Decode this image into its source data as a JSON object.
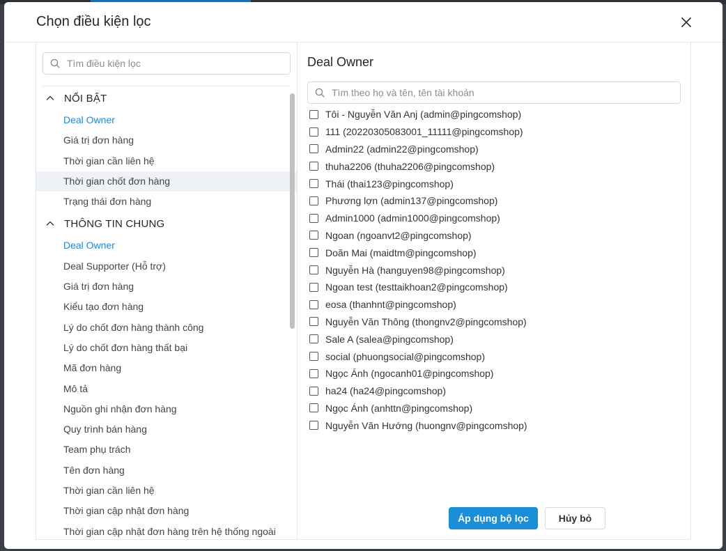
{
  "modal": {
    "title": "Chọn điều kiện lọc"
  },
  "left": {
    "search_placeholder": "Tìm điều kiện lọc",
    "groups": [
      {
        "title": "NỔI BẬT",
        "items": [
          {
            "label": "Deal Owner"
          },
          {
            "label": "Giá trị đơn hàng"
          },
          {
            "label": "Thời gian cần liên hệ"
          },
          {
            "label": "Thời gian chốt đơn hàng"
          },
          {
            "label": "Trạng thái đơn hàng"
          }
        ]
      },
      {
        "title": "THÔNG TIN CHUNG",
        "items": [
          {
            "label": "Deal Owner"
          },
          {
            "label": "Deal Supporter (Hỗ trợ)"
          },
          {
            "label": "Giá trị đơn hàng"
          },
          {
            "label": "Kiểu tạo đơn hàng"
          },
          {
            "label": "Lý do chốt đơn hàng thành công"
          },
          {
            "label": "Lý do chốt đơn hàng thất bại"
          },
          {
            "label": "Mã đơn hàng"
          },
          {
            "label": "Mô tả"
          },
          {
            "label": "Nguồn ghi nhận đơn hàng"
          },
          {
            "label": "Quy trình bán hàng"
          },
          {
            "label": "Team phụ trách"
          },
          {
            "label": "Tên đơn hàng"
          },
          {
            "label": "Thời gian cần liên hệ"
          },
          {
            "label": "Thời gian cập nhật đơn hàng"
          },
          {
            "label": "Thời gian cập nhật đơn hàng trên hệ thống ngoài"
          }
        ]
      }
    ]
  },
  "right": {
    "title": "Deal Owner",
    "search_placeholder": "Tìm theo họ và tên, tên tài khoản",
    "owners": [
      {
        "label": "Tôi - Nguyễn Văn Anj (admin@pingcomshop)"
      },
      {
        "label": "111 (20220305083001_11111@pingcomshop)"
      },
      {
        "label": "Admin22 (admin22@pingcomshop)"
      },
      {
        "label": "thuha2206 (thuha2206@pingcomshop)"
      },
      {
        "label": "Thái (thai123@pingcomshop)"
      },
      {
        "label": "Phương lợn (admin137@pingcomshop)"
      },
      {
        "label": "Admin1000 (admin1000@pingcomshop)"
      },
      {
        "label": "Ngoan (ngoanvt2@pingcomshop)"
      },
      {
        "label": "Doãn Mai (maidtm@pingcomshop)"
      },
      {
        "label": "Nguyễn Hà (hanguyen98@pingcomshop)"
      },
      {
        "label": "Ngoan test (testtaikhoan2@pingcomshop)"
      },
      {
        "label": "eosa (thanhnt@pingcomshop)"
      },
      {
        "label": "Nguyễn Văn Thông (thongnv2@pingcomshop)"
      },
      {
        "label": "Sale A (salea@pingcomshop)"
      },
      {
        "label": "social (phuongsocial@pingcomshop)"
      },
      {
        "label": "Ngọc Ánh (ngocanh01@pingcomshop)"
      },
      {
        "label": "ha24 (ha24@pingcomshop)"
      },
      {
        "label": "Ngọc Ánh (anhttn@pingcomshop)"
      },
      {
        "label": "Nguyễn Văn Hướng (huongnv@pingcomshop)"
      }
    ],
    "apply_label": "Áp dụng bộ lọc",
    "cancel_label": "Hủy bỏ"
  },
  "colors": {
    "accent": "#1a8fd8",
    "active_link": "#1e88d6",
    "hover_row": "#eef1f5"
  }
}
